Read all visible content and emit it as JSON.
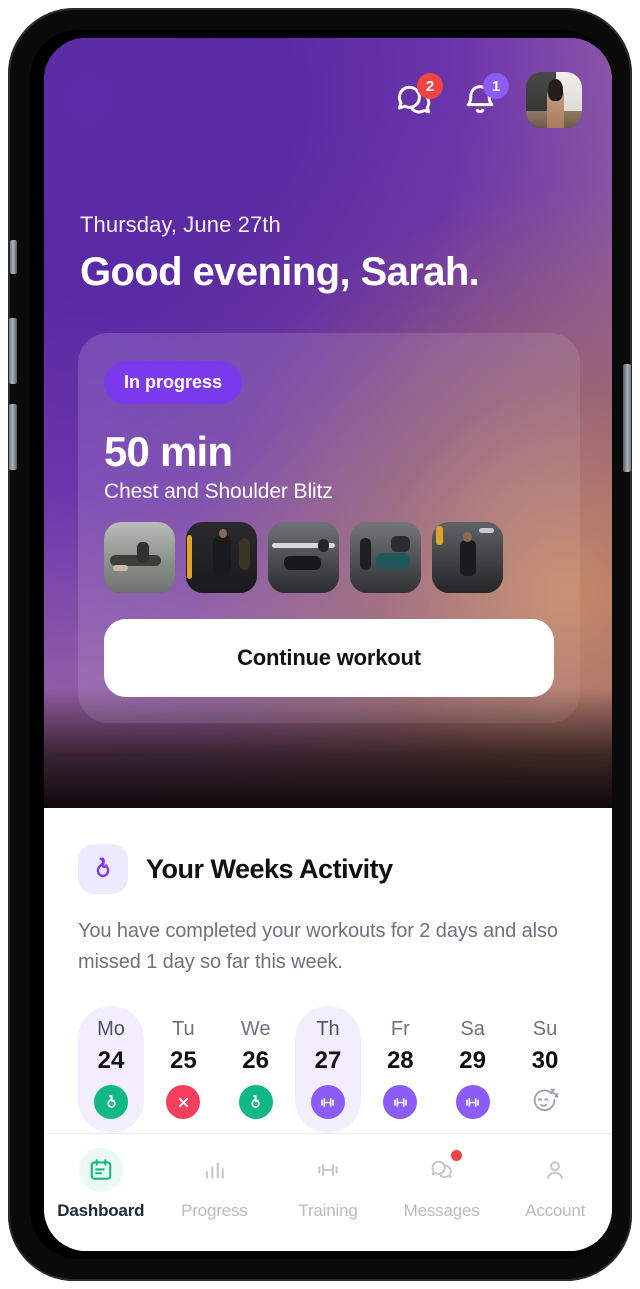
{
  "header": {
    "messages_icon": "chat-bubbles-icon",
    "messages_badge": "2",
    "notifications_icon": "bell-icon",
    "notifications_badge": "1",
    "avatar_label": "Sarah"
  },
  "greeting": {
    "date": "Thursday, June 27th",
    "hello": "Good evening, Sarah."
  },
  "workout_card": {
    "status": "In progress",
    "duration": "50 min",
    "name": "Chest and Shoulder Blitz",
    "cta": "Continue workout",
    "thumbnails": [
      {
        "alt": "push-up-exercise"
      },
      {
        "alt": "standing-dumbbell-exercise"
      },
      {
        "alt": "bench-press-exercise"
      },
      {
        "alt": "incline-press-exercise"
      },
      {
        "alt": "shoulder-press-exercise"
      }
    ]
  },
  "activity": {
    "icon": "flame-icon",
    "title": "Your Weeks Activity",
    "description": "You have completed your workouts for 2 days and also missed 1 day so far this week.",
    "days": [
      {
        "dow": "Mo",
        "num": "24",
        "state": "done",
        "icon": "flame-icon"
      },
      {
        "dow": "Tu",
        "num": "25",
        "state": "miss",
        "icon": "close-x-icon"
      },
      {
        "dow": "We",
        "num": "26",
        "state": "done",
        "icon": "flame-icon"
      },
      {
        "dow": "Th",
        "num": "27",
        "state": "plan",
        "icon": "dumbbell-icon",
        "today": true
      },
      {
        "dow": "Fr",
        "num": "28",
        "state": "plan",
        "icon": "dumbbell-icon"
      },
      {
        "dow": "Sa",
        "num": "29",
        "state": "plan",
        "icon": "dumbbell-icon"
      },
      {
        "dow": "Su",
        "num": "30",
        "state": "rest",
        "icon": "sleeping-face-icon"
      }
    ]
  },
  "bottom_nav": {
    "items": [
      {
        "label": "Dashboard",
        "icon": "calendar-icon",
        "active": true
      },
      {
        "label": "Progress",
        "icon": "bar-chart-icon",
        "active": false
      },
      {
        "label": "Training",
        "icon": "dumbbell-icon",
        "active": false
      },
      {
        "label": "Messages",
        "icon": "chat-bubbles-icon",
        "active": false,
        "dot": true
      },
      {
        "label": "Account",
        "icon": "person-icon",
        "active": false
      }
    ]
  },
  "colors": {
    "accent_purple": "#7c3aed",
    "badge_red": "#ef4444",
    "badge_purple": "#8b5cf6",
    "success_green": "#10b981",
    "miss_red": "#f43f5e",
    "today_bg": "#f2eefe"
  }
}
